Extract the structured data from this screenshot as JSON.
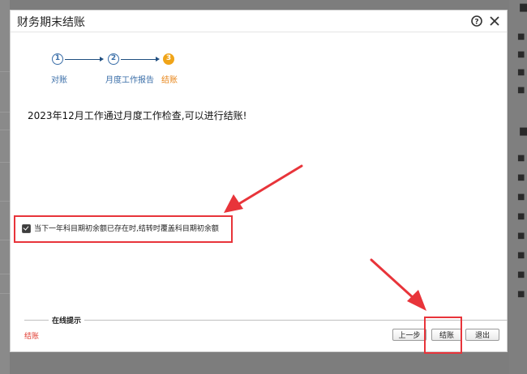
{
  "dialog": {
    "title": "财务期末结账"
  },
  "icons": {
    "help": "help-icon",
    "close": "close-icon"
  },
  "steps": [
    {
      "number": "1",
      "label": "对账",
      "active": false
    },
    {
      "number": "2",
      "label": "月度工作报告",
      "active": false
    },
    {
      "number": "3",
      "label": "结账",
      "active": true
    }
  ],
  "message": "2023年12月工作通过月度工作检查,可以进行结账!",
  "checkbox": {
    "label": "当下一年科目期初余额已存在时,结转时覆盖科目期初余额",
    "checked": true
  },
  "tip": {
    "title": "在线提示",
    "text": "结账"
  },
  "buttons": {
    "prev": "上一步",
    "close_account": "结账",
    "exit": "退出"
  },
  "colors": {
    "step_blue": "#3a6ea8",
    "step_active": "#f0a418",
    "annotation_red": "#e8343a",
    "tip_red": "#e03a2e"
  }
}
